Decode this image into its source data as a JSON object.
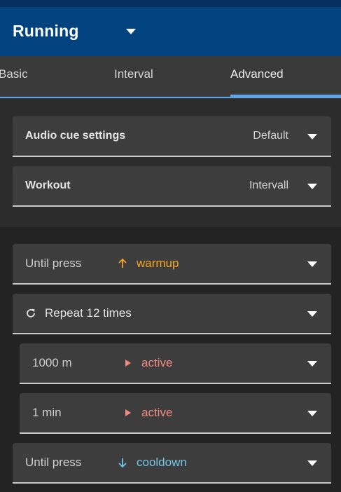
{
  "app": {
    "title": "Running",
    "caret_icon": "chevron-down-icon"
  },
  "tabs": [
    {
      "label": "Basic",
      "active": false
    },
    {
      "label": "Interval",
      "active": false
    },
    {
      "label": "Advanced",
      "active": true
    }
  ],
  "settings": {
    "audio_cue": {
      "label": "Audio cue settings",
      "value": "Default"
    },
    "workout": {
      "label": "Workout",
      "value": "Intervall"
    }
  },
  "steps": [
    {
      "duration": "Until press",
      "type": "warmup",
      "icon": "arrow-up-icon",
      "color": "#f5a623"
    },
    {
      "repeat_label": "Repeat 12 times",
      "icon": "refresh-icon"
    },
    {
      "duration": "1000 m",
      "type": "active",
      "icon": "play-icon",
      "color": "#f28b82"
    },
    {
      "duration": "1 min",
      "type": "active",
      "icon": "play-icon",
      "color": "#f28b82"
    },
    {
      "duration": "Until press",
      "type": "cooldown",
      "icon": "arrow-down-icon",
      "color": "#71c6e8"
    }
  ],
  "colors": {
    "appbar": "#02437f",
    "accent": "#5ea6e8",
    "background": "#212121"
  }
}
